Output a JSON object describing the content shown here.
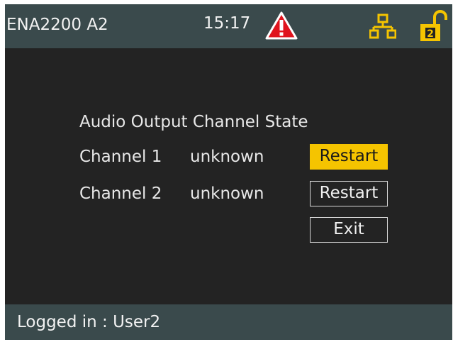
{
  "header": {
    "title": "ENA2200 A2",
    "time": "15:17",
    "icons": [
      "warning-icon",
      "network-icon",
      "unlock-level-icon"
    ],
    "lock_level": "2"
  },
  "main": {
    "heading": "Audio Output Channel State",
    "channels": [
      {
        "label": "Channel 1",
        "state": "unknown",
        "button": "Restart"
      },
      {
        "label": "Channel 2",
        "state": "unknown",
        "button": "Restart"
      }
    ],
    "exit_label": "Exit"
  },
  "footer": {
    "status": "Logged in : User2"
  },
  "colors": {
    "bar_bg": "#3a4a4c",
    "screen_bg": "#232323",
    "accent_yellow": "#f5c400",
    "warning_red": "#e0141e"
  }
}
